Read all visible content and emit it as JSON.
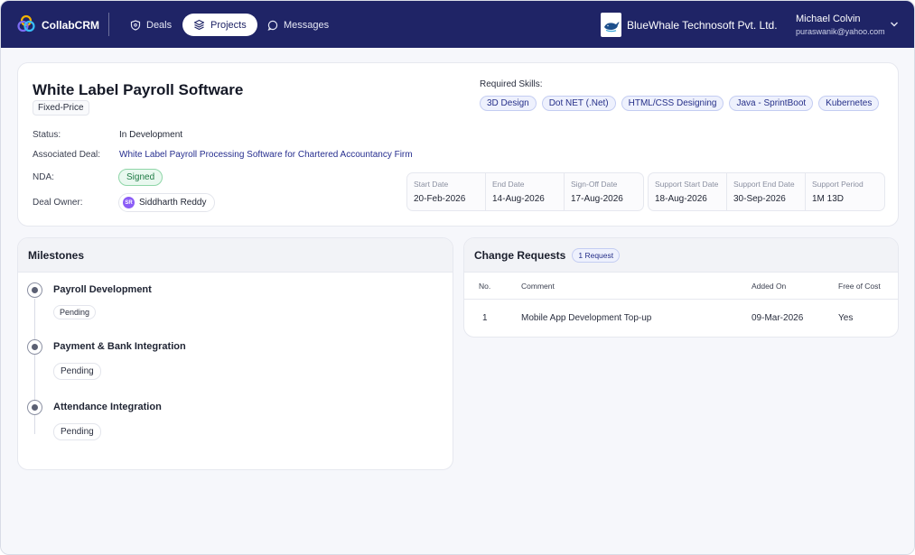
{
  "app": {
    "name": "CollabCRM"
  },
  "nav": {
    "items": [
      {
        "label": "Deals",
        "icon": "shield-icon",
        "active": false
      },
      {
        "label": "Projects",
        "icon": "layers-icon",
        "active": true
      },
      {
        "label": "Messages",
        "icon": "chat-icon",
        "active": false
      }
    ]
  },
  "org": {
    "name": "BlueWhale Technosoft Pvt. Ltd."
  },
  "user": {
    "name": "Michael Colvin",
    "email": "puraswanik@yahoo.com"
  },
  "project": {
    "title": "White Label Payroll Software",
    "type": "Fixed-Price",
    "fields": {
      "status_label": "Status:",
      "status_value": "In Development",
      "deal_label": "Associated Deal:",
      "deal_value": "White Label Payroll Processing Software for Chartered Accountancy Firm",
      "nda_label": "NDA:",
      "nda_value": "Signed",
      "owner_label": "Deal Owner:",
      "owner_initials": "SR",
      "owner_value": "Siddharth Reddy"
    },
    "skills_label": "Required Skills:",
    "skills": [
      "3D Design",
      "Dot NET (.Net)",
      "HTML/CSS Designing",
      "Java - SprintBoot",
      "Kubernetes"
    ],
    "dates": [
      {
        "label": "Start Date",
        "value": "20-Feb-2026"
      },
      {
        "label": "End Date",
        "value": "14-Aug-2026"
      },
      {
        "label": "Sign-Off Date",
        "value": "17-Aug-2026"
      }
    ],
    "support": [
      {
        "label": "Support Start Date",
        "value": "18-Aug-2026"
      },
      {
        "label": "Support End Date",
        "value": "30-Sep-2026"
      },
      {
        "label": "Support Period",
        "value": "1M 13D"
      }
    ]
  },
  "milestones": {
    "title": "Milestones",
    "items": [
      {
        "title": "Payroll Development",
        "status": "Pending"
      },
      {
        "title": "Payment & Bank Integration",
        "status": "Pending"
      },
      {
        "title": "Attendance Integration",
        "status": "Pending"
      }
    ]
  },
  "change_requests": {
    "title": "Change Requests",
    "count": "1 Request",
    "columns": [
      "No.",
      "Comment",
      "Added On",
      "Free of Cost"
    ],
    "rows": [
      [
        "1",
        "Mobile App Development Top-up",
        "09-Mar-2026",
        "Yes"
      ]
    ]
  },
  "colors": {
    "nav_bg": "#1f2466",
    "accent": "#263089",
    "success": "#1e7a44"
  }
}
